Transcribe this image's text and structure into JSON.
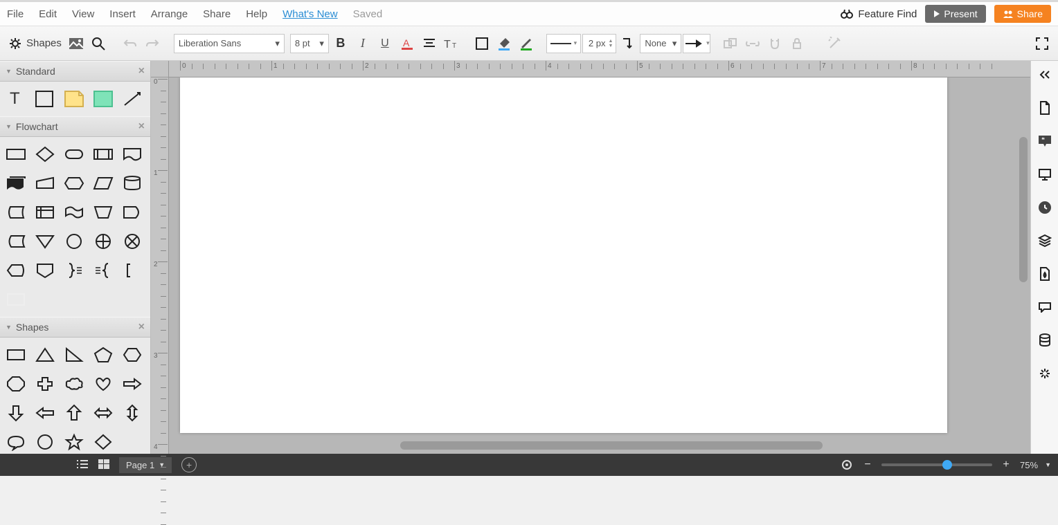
{
  "menu": {
    "items": [
      "File",
      "Edit",
      "View",
      "Insert",
      "Arrange",
      "Share",
      "Help"
    ],
    "whats_new": "What's New",
    "saved": "Saved",
    "feature_find": "Feature Find",
    "present": "Present",
    "share_btn": "Share"
  },
  "toolbar": {
    "shapes_label": "Shapes",
    "font": "Liberation Sans",
    "font_size": "8 pt",
    "line_width": "2 px",
    "line_start": "None"
  },
  "panels": {
    "standard": {
      "title": "Standard"
    },
    "flowchart": {
      "title": "Flowchart"
    },
    "shapes": {
      "title": "Shapes"
    }
  },
  "ruler": {
    "h_labels": [
      "0",
      "1",
      "2",
      "3",
      "4",
      "5",
      "6",
      "7",
      "8"
    ],
    "v_labels": [
      "0",
      "1",
      "2",
      "3",
      "4"
    ]
  },
  "bottom": {
    "page_label": "Page 1",
    "zoom": "75%"
  }
}
